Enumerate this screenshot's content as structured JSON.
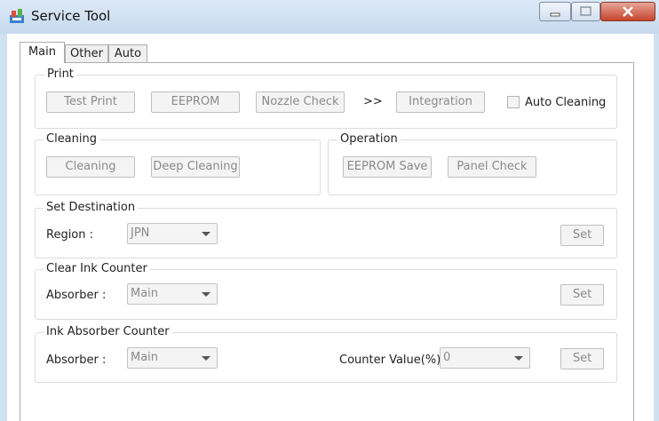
{
  "window": {
    "title": "Service Tool"
  },
  "tabs": [
    "Main",
    "Other",
    "Auto"
  ],
  "print": {
    "label": "Print",
    "buttons": {
      "test_print": "Test Print",
      "eeprom": "EEPROM",
      "nozzle_check": "Nozzle Check",
      "integration": "Integration"
    },
    "arrow": ">>",
    "auto_cleaning": "Auto Cleaning"
  },
  "cleaning": {
    "label": "Cleaning",
    "buttons": {
      "cleaning": "Cleaning",
      "deep_cleaning": "Deep Cleaning"
    }
  },
  "operation": {
    "label": "Operation",
    "buttons": {
      "eeprom_save": "EEPROM Save",
      "panel_check": "Panel Check"
    }
  },
  "set_destination": {
    "label": "Set Destination",
    "region_label": "Region :",
    "region_value": "JPN",
    "set": "Set"
  },
  "clear_ink_counter": {
    "label": "Clear Ink Counter",
    "absorber_label": "Absorber :",
    "absorber_value": "Main",
    "set": "Set"
  },
  "ink_absorber_counter": {
    "label": "Ink Absorber Counter",
    "absorber_label": "Absorber :",
    "absorber_value": "Main",
    "counter_label": "Counter Value(%)",
    "counter_value": "0",
    "set": "Set"
  },
  "icons": {
    "app": "service-tool-app-icon",
    "min": "minimize-icon",
    "max": "maximize-icon",
    "close": "close-icon",
    "dropdown": "chevron-down-icon"
  }
}
